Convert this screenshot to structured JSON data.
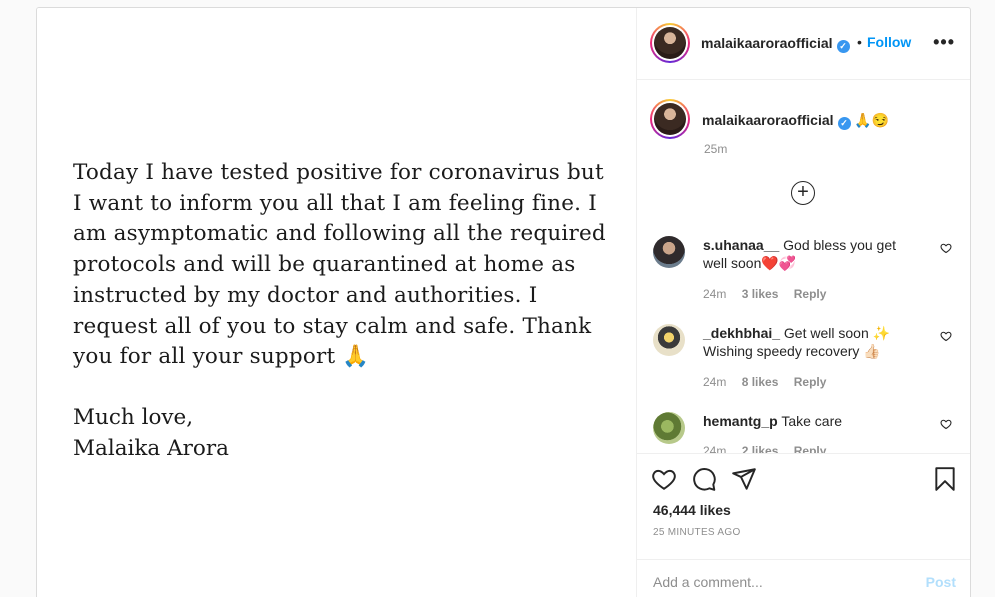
{
  "post": {
    "media": {
      "lines": [
        "Today I have tested positive for coronavirus but",
        "I want to inform you all that I am feeling fine. I",
        "am asymptomatic and following all the required",
        "protocols and will be quarantined at home as",
        "instructed by my doctor and authorities. I",
        "request all of you to stay calm and safe. Thank",
        "you for all your support 🙏"
      ],
      "signoff": [
        "Much love,",
        "Malaika Arora"
      ]
    },
    "header": {
      "username": "malaikaaroraofficial",
      "separator": "•",
      "follow_label": "Follow",
      "more_label": "•••"
    },
    "caption": {
      "username": "malaikaaroraofficial",
      "text": "🙏😏",
      "time": "25m"
    },
    "load_more": "⊕",
    "comments": [
      {
        "username": "s.uhanaa__",
        "text": "God bless you get well soon❤️💞",
        "time": "24m",
        "likes": "3 likes",
        "reply": "Reply"
      },
      {
        "username": "_dekhbhai_",
        "text": "Get well soon ✨ Wishing speedy recovery 👍🏻",
        "time": "24m",
        "likes": "8 likes",
        "reply": "Reply"
      },
      {
        "username": "hemantg_p",
        "text": "Take care",
        "time": "24m",
        "likes": "2 likes",
        "reply": "Reply"
      }
    ],
    "actions": {
      "likes": "46,444 likes",
      "time_ago": "25 MINUTES AGO",
      "icons": [
        "heart-icon",
        "comment-icon",
        "share-icon",
        "bookmark-icon"
      ]
    },
    "add_comment": {
      "placeholder": "Add a comment...",
      "post_label": "Post"
    },
    "colors": {
      "link": "#0095f6",
      "post_disabled": "#b2dffc",
      "muted": "#8e8e8e",
      "verified": "#3897f0"
    }
  }
}
